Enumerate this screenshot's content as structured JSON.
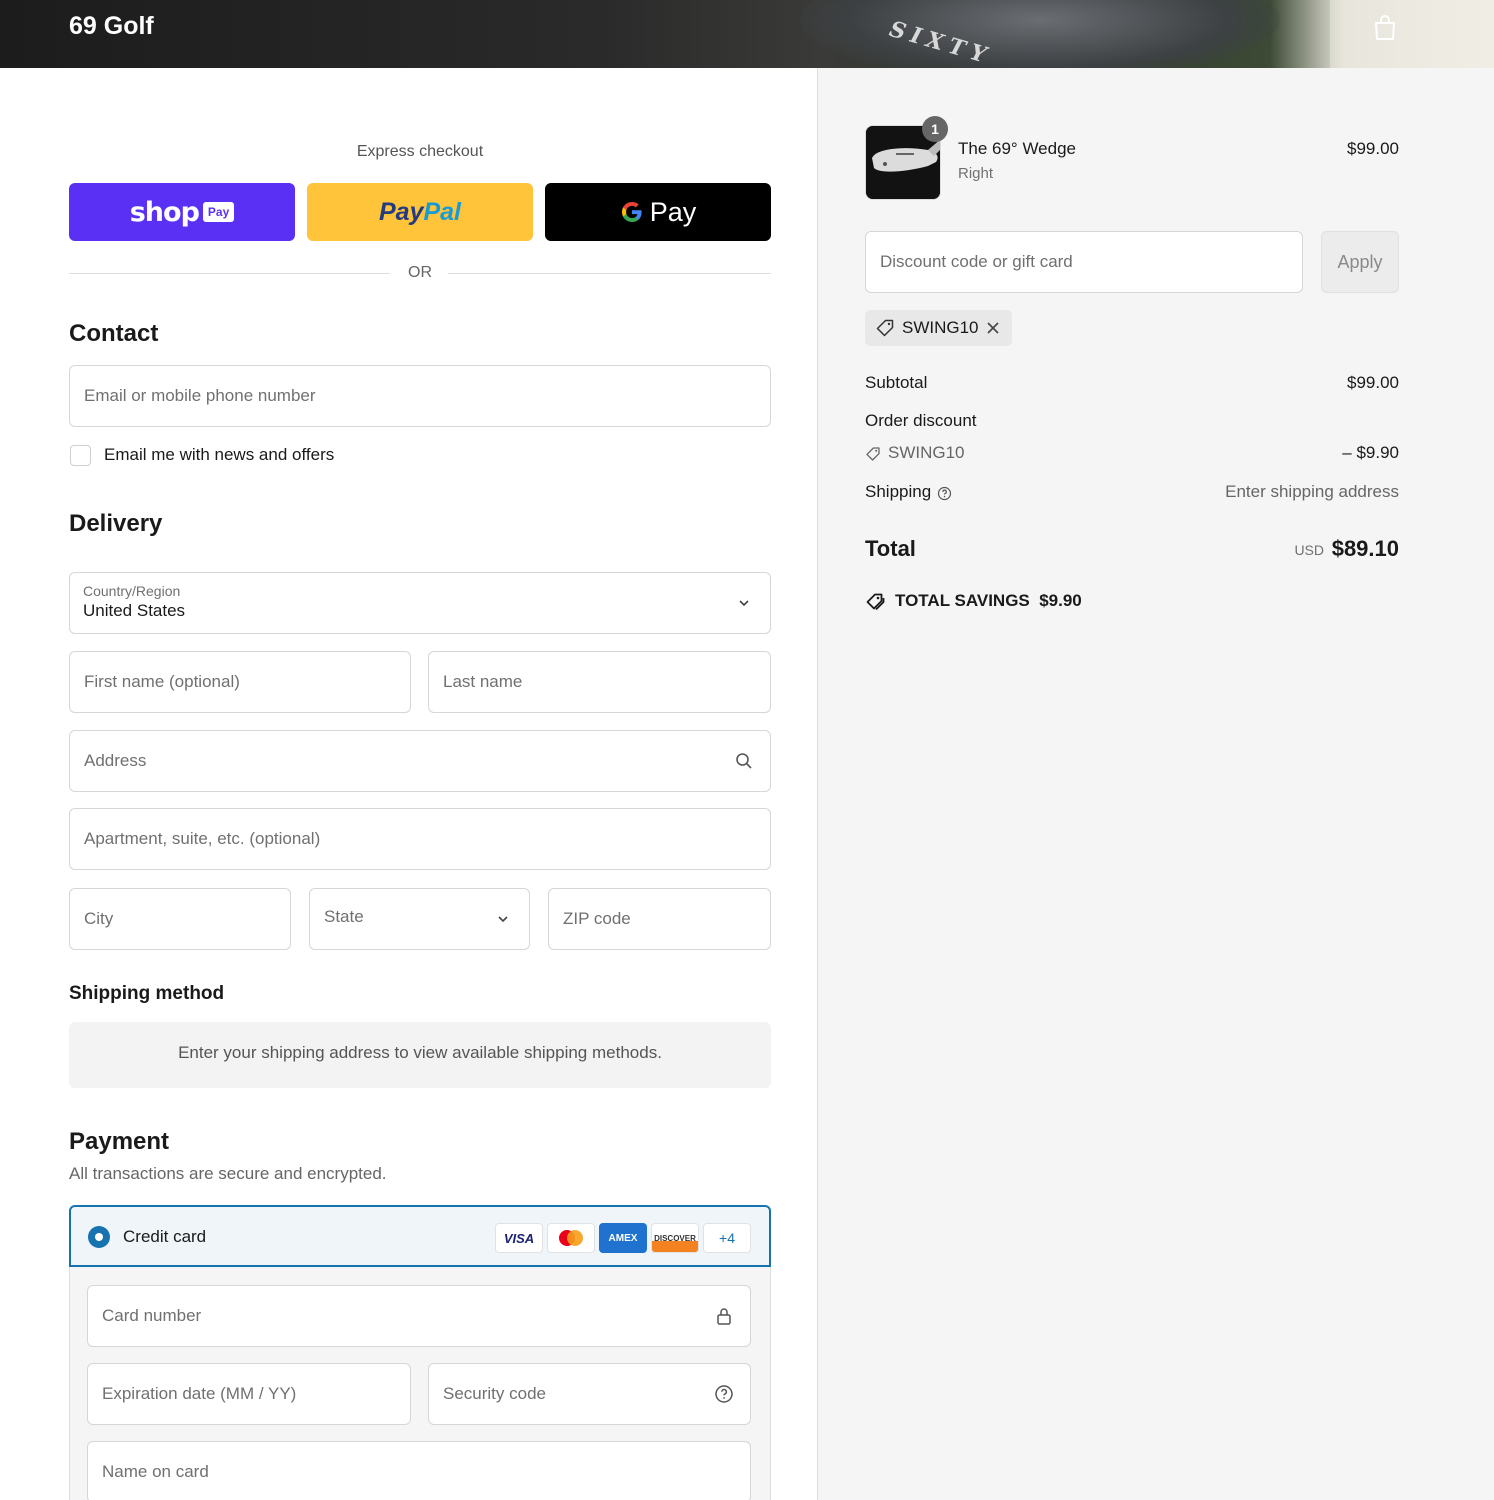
{
  "header": {
    "brand": "69 Golf",
    "banner_text": "SIXTY",
    "cart_icon": "bag-icon"
  },
  "express": {
    "title": "Express checkout",
    "shop_pay": {
      "word": "shop",
      "badge": "Pay",
      "color": "#5a31f4"
    },
    "paypal": {
      "pay": "Pay",
      "pal": "Pal",
      "color": "#ffc439"
    },
    "gpay": {
      "g": "G",
      "pay": "Pay",
      "color": "#000000"
    },
    "or": "OR"
  },
  "contact": {
    "title": "Contact",
    "email_placeholder": "Email or mobile phone number",
    "newsletter_label": "Email me with news and offers",
    "newsletter_checked": false
  },
  "delivery": {
    "title": "Delivery",
    "country_label": "Country/Region",
    "country_value": "United States",
    "first_name_placeholder": "First name (optional)",
    "last_name_placeholder": "Last name",
    "address_placeholder": "Address",
    "apartment_placeholder": "Apartment, suite, etc. (optional)",
    "city_placeholder": "City",
    "state_placeholder": "State",
    "zip_placeholder": "ZIP code"
  },
  "shipping_method": {
    "title": "Shipping method",
    "message": "Enter your shipping address to view available shipping methods."
  },
  "payment": {
    "title": "Payment",
    "subtitle": "All transactions are secure and encrypted.",
    "method_label": "Credit card",
    "card_logos": [
      "VISA",
      "mastercard",
      "AMEX",
      "DISCOVER"
    ],
    "more_cards": "+4",
    "card_number_placeholder": "Card number",
    "expiry_placeholder": "Expiration date (MM / YY)",
    "security_placeholder": "Security code",
    "name_placeholder": "Name on card",
    "accent": "#1773b0"
  },
  "summary": {
    "item": {
      "name": "The 69° Wedge",
      "variant": "Right",
      "price": "$99.00",
      "quantity": "1"
    },
    "discount_placeholder": "Discount code or gift card",
    "apply_label": "Apply",
    "applied_code": "SWING10",
    "subtotal_label": "Subtotal",
    "subtotal_value": "$99.00",
    "order_discount_label": "Order discount",
    "discount_code": "SWING10",
    "discount_value": "– $9.90",
    "shipping_label": "Shipping",
    "shipping_value": "Enter shipping address",
    "total_label": "Total",
    "total_currency": "USD",
    "total_value": "$89.10",
    "savings_label": "TOTAL SAVINGS",
    "savings_value": "$9.90"
  }
}
